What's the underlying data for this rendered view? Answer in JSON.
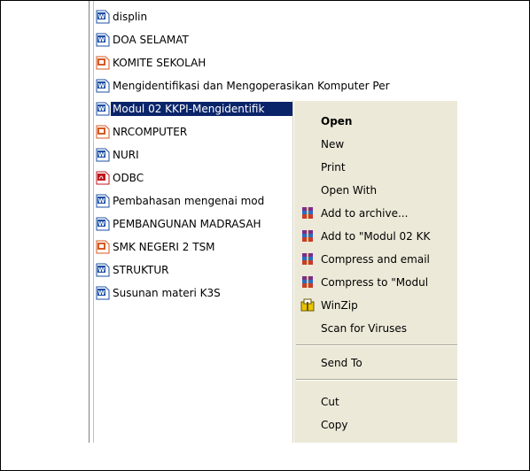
{
  "files": [
    {
      "name": "displin",
      "icon": "word-doc-icon"
    },
    {
      "name": "DOA SELAMAT",
      "icon": "word-doc-icon"
    },
    {
      "name": "KOMITE SEKOLAH",
      "icon": "powerpoint-icon"
    },
    {
      "name": "Mengidentifikasi dan Mengoperasikan Komputer Per",
      "icon": "word-doc-icon"
    },
    {
      "name": "Modul 02 KKPI-Mengidentifik",
      "icon": "word-doc-icon",
      "selected": true
    },
    {
      "name": "NRCOMPUTER",
      "icon": "powerpoint-icon"
    },
    {
      "name": "NURI",
      "icon": "word-doc-icon"
    },
    {
      "name": "ODBC",
      "icon": "acrobat-pdf-icon"
    },
    {
      "name": "Pembahasan mengenai mod",
      "icon": "word-doc-icon"
    },
    {
      "name": "PEMBANGUNAN MADRASAH",
      "icon": "word-doc-icon"
    },
    {
      "name": "SMK NEGERI 2 TSM",
      "icon": "powerpoint-icon"
    },
    {
      "name": "STRUKTUR",
      "icon": "word-doc-icon"
    },
    {
      "name": "Susunan materi K3S",
      "icon": "word-doc-icon"
    }
  ],
  "context_menu": {
    "open": "Open",
    "new": "New",
    "print": "Print",
    "open_with": "Open With",
    "add_to_archive": "Add to archive...",
    "add_to_named": "Add to \"Modul 02 KK",
    "compress_email": "Compress and email",
    "compress_to": "Compress to \"Modul",
    "winzip": "WinZip",
    "scan_viruses": "Scan for Viruses",
    "send_to": "Send To",
    "cut": "Cut",
    "copy": "Copy"
  },
  "colors": {
    "selection": "#0a246a",
    "menu_background": "#ece9d8",
    "word_icon": "#1c4fa5",
    "powerpoint_icon": "#d65a24",
    "pdf_icon": "#c0161b"
  }
}
